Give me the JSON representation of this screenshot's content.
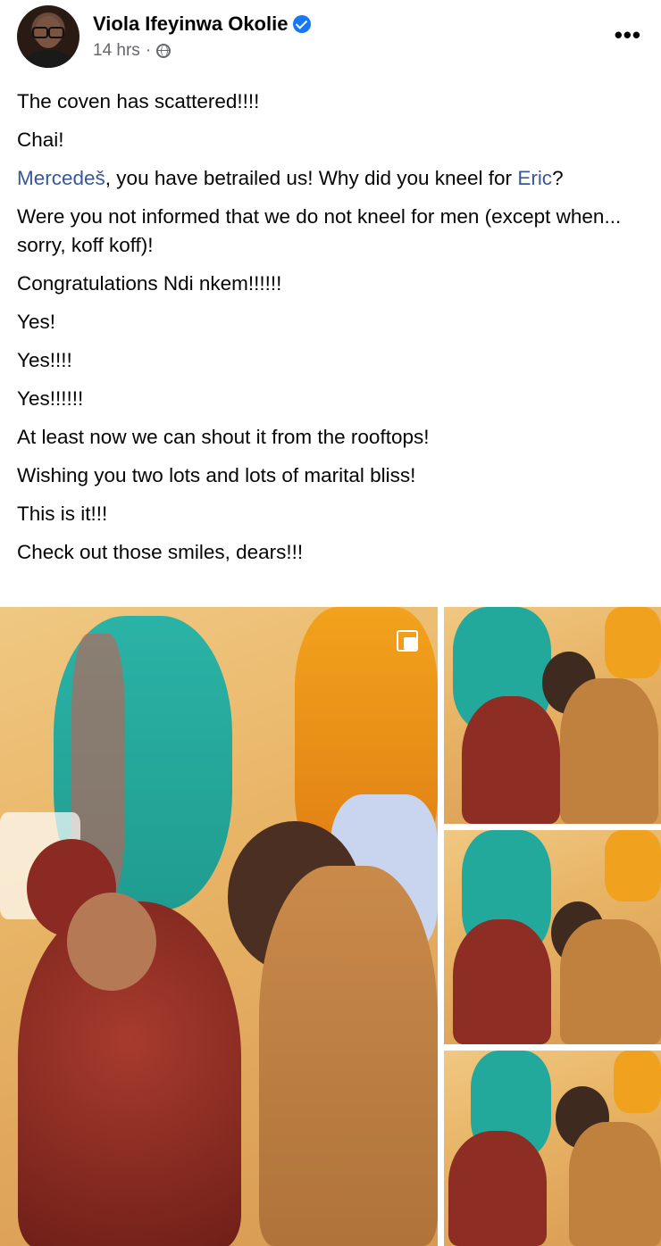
{
  "post": {
    "author": "Viola Ifeyinwa Okolie",
    "verified": true,
    "time": "14 hrs",
    "separator": "·",
    "audience_icon": "globe-icon",
    "more_icon": "•••",
    "lines": [
      {
        "text": "The coven has scattered!!!!"
      },
      {
        "text": "Chai!"
      },
      {
        "mention1": "Mercedeš",
        "mid": ", you have betrailed us! Why did you kneel for ",
        "mention2": "Eric",
        "end": "?"
      },
      {
        "text": "Were you not informed that we do not kneel for men (except when... sorry, koff koff)!"
      },
      {
        "text": "Congratulations Ndi nkem!!!!!!"
      },
      {
        "text": "Yes!"
      },
      {
        "text": "Yes!!!!"
      },
      {
        "text": "Yes!!!!!!"
      },
      {
        "text": "At least now we can shout it from the rooftops!"
      },
      {
        "text": "Wishing you two lots and lots of marital bliss!"
      },
      {
        "text": "This is it!!!"
      },
      {
        "text": "Check out those smiles, dears!!!"
      }
    ]
  },
  "photos": {
    "count": 4,
    "multi_icon": "multiple-photos-icon"
  },
  "colors": {
    "mention": "#385898",
    "verified": "#1877f2",
    "meta": "#65676b"
  }
}
